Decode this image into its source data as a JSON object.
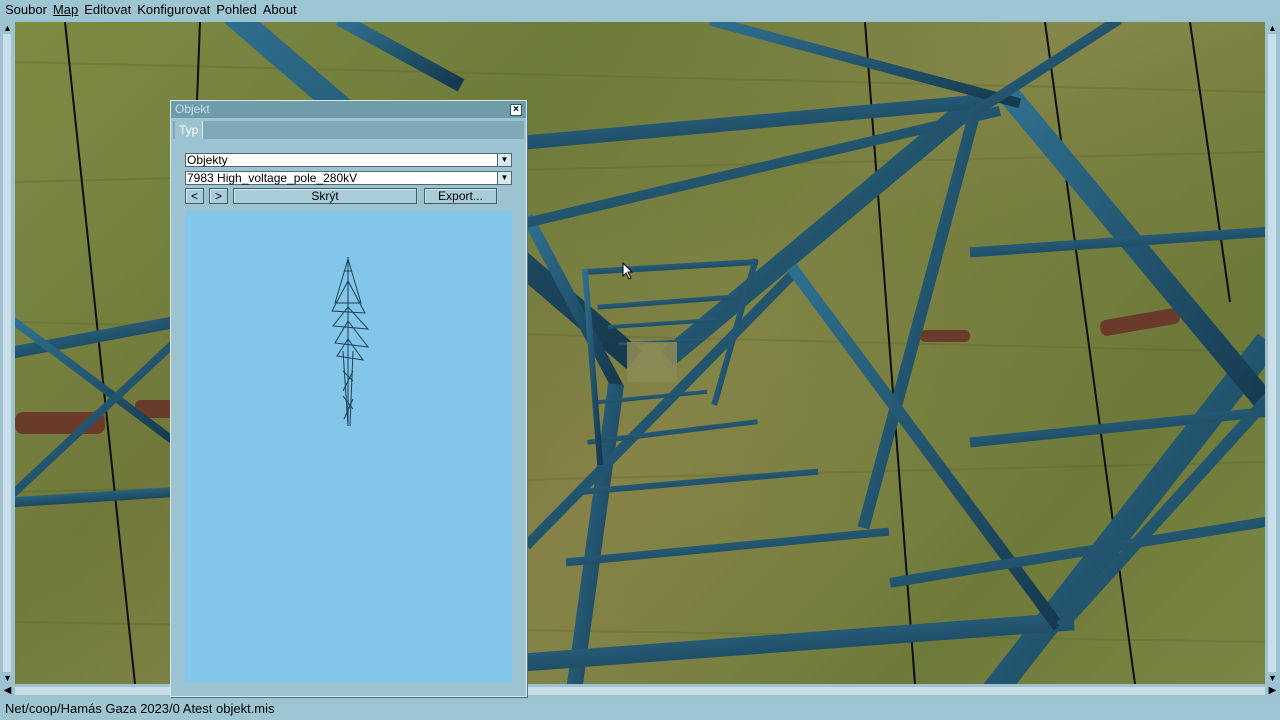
{
  "menu": {
    "items": [
      {
        "label": "Soubor"
      },
      {
        "label": "Map"
      },
      {
        "label": "Editovat"
      },
      {
        "label": "Konfigurovat"
      },
      {
        "label": "Pohled"
      },
      {
        "label": "About"
      }
    ]
  },
  "dialog": {
    "title": "Objekt",
    "close_icon": "close-icon",
    "tabs": [
      {
        "label": "Typ"
      }
    ],
    "category_select": {
      "value": "Objekty"
    },
    "object_select": {
      "value": "7983 High_voltage_pole_280kV"
    },
    "prev_label": "<",
    "next_label": ">",
    "hide_label": "Skrýt",
    "export_label": "Export...",
    "preview_bg": "#82c6e9"
  },
  "status": {
    "path": "Net/coop/Hamás Gaza 2023/0 Atest objekt.mis"
  },
  "colors": {
    "ui_bg": "#9cc3cf",
    "steel": "#1f4d66"
  }
}
